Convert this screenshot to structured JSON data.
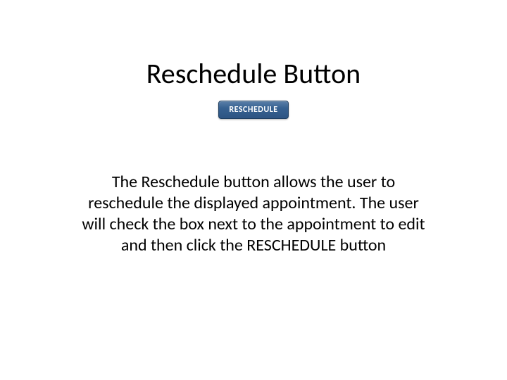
{
  "title": "Reschedule Button",
  "button": {
    "label": "RESCHEDULE"
  },
  "description": "The Reschedule button allows the user to reschedule the displayed appointment. The user will check the box next to the appointment to edit and then click the RESCHEDULE button"
}
